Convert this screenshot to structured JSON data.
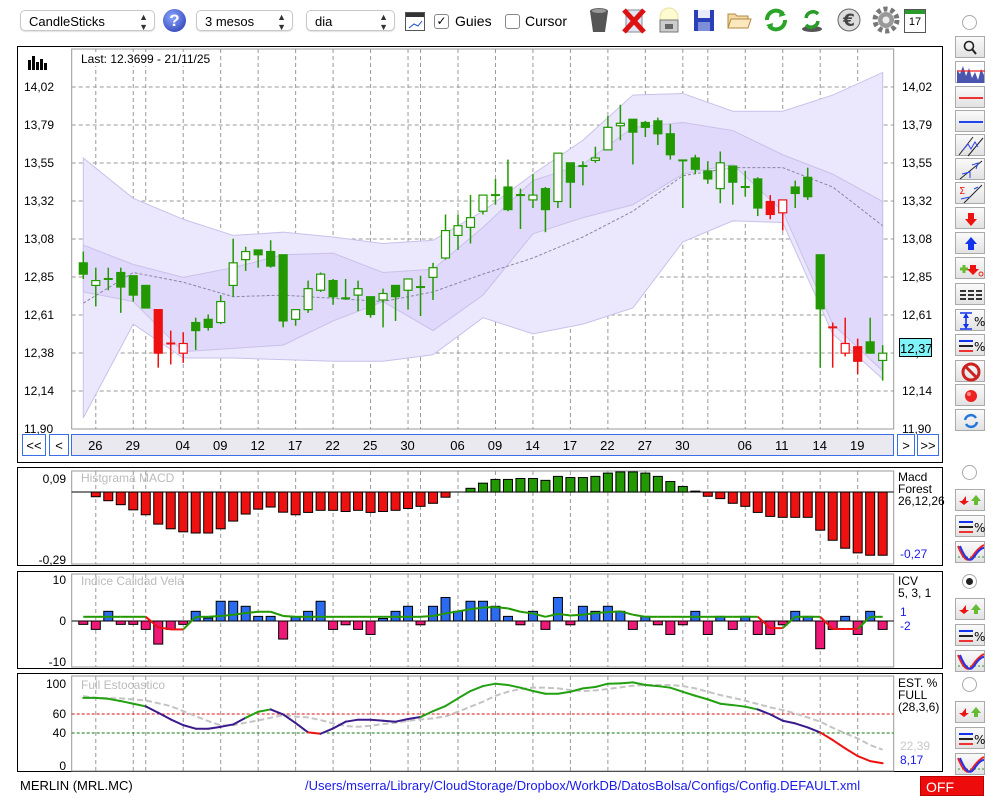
{
  "toolbar": {
    "chart_type": "CandleSticks",
    "period": "3 mesos",
    "interval": "dia",
    "guides_label": "Guies",
    "guides_checked": true,
    "cursor_label": "Cursor",
    "cursor_checked": false,
    "check_mark": "✓",
    "help_glyph": "?",
    "calendar_day": "17",
    "icons": [
      "help-icon",
      "chart-window-icon",
      "trash-icon",
      "delete-icon",
      "lightbulb-icon",
      "save-icon",
      "folder-icon",
      "refresh-icon",
      "recycle-icon",
      "euro-icon",
      "gear-icon",
      "calendar-icon"
    ]
  },
  "main": {
    "last_label": "Last: 12.3699 - 21/11/25",
    "current_price": "12,37",
    "nav": {
      "first": "<<",
      "prev": "<",
      "next": ">",
      "last": ">>"
    },
    "x_labels": [
      {
        "i": 1,
        "label": "26"
      },
      {
        "i": 4,
        "label": "29"
      },
      {
        "i": 8,
        "label": "04"
      },
      {
        "i": 11,
        "label": "09"
      },
      {
        "i": 14,
        "label": "12"
      },
      {
        "i": 17,
        "label": "17"
      },
      {
        "i": 20,
        "label": "22"
      },
      {
        "i": 23,
        "label": "25"
      },
      {
        "i": 26,
        "label": "30"
      },
      {
        "i": 30,
        "label": "06"
      },
      {
        "i": 33,
        "label": "09"
      },
      {
        "i": 36,
        "label": "14"
      },
      {
        "i": 39,
        "label": "17"
      },
      {
        "i": 42,
        "label": "22"
      },
      {
        "i": 45,
        "label": "27"
      },
      {
        "i": 48,
        "label": "30"
      },
      {
        "i": 53,
        "label": "06"
      },
      {
        "i": 56,
        "label": "11"
      },
      {
        "i": 59,
        "label": "14"
      },
      {
        "i": 62,
        "label": "19"
      }
    ],
    "month_grid_indices": [
      5,
      27,
      50
    ]
  },
  "colors": {
    "up": "#229900",
    "alert": "#ee1111",
    "band_outer": "#ebe7fd",
    "band_inner": "#e0d9fb",
    "band_stroke": "#c9c1ea",
    "macd_neg": "#ee1111",
    "macd_pos": "#229900",
    "icv_pos": "#2a6bf0",
    "icv_neg": "#ee1877",
    "k_high": "#22a011",
    "k_mid": "#3a1a8c",
    "k_low": "#ee1111",
    "d_line": "#c4c4c4",
    "link": "#1a1aee",
    "price_box": "#7ff3f7"
  },
  "chart_data": [
    {
      "type": "candlestick",
      "ylim": [
        11.9,
        14.02
      ],
      "y_tick_labels": [
        "14,02",
        "13,79",
        "13,55",
        "13,32",
        "13,08",
        "12,85",
        "12,61",
        "12,38",
        "12,14",
        "11,90"
      ],
      "ohlc_fields": [
        "open",
        "high",
        "low",
        "close",
        "color"
      ],
      "ohlc": [
        [
          12.93,
          13.0,
          12.83,
          12.86,
          "g"
        ],
        [
          12.79,
          12.9,
          12.66,
          12.82,
          "g"
        ],
        [
          12.83,
          12.9,
          12.76,
          12.83,
          "g"
        ],
        [
          12.87,
          12.9,
          12.62,
          12.78,
          "g"
        ],
        [
          12.85,
          12.85,
          12.69,
          12.73,
          "g"
        ],
        [
          12.79,
          12.79,
          12.65,
          12.65,
          "g"
        ],
        [
          12.64,
          12.64,
          12.28,
          12.37,
          "r"
        ],
        [
          12.43,
          12.51,
          12.3,
          12.43,
          "r"
        ],
        [
          12.37,
          12.5,
          12.31,
          12.43,
          "r"
        ],
        [
          12.56,
          12.59,
          12.39,
          12.51,
          "g"
        ],
        [
          12.58,
          12.61,
          12.51,
          12.53,
          "g"
        ],
        [
          12.56,
          12.73,
          12.55,
          12.69,
          "g"
        ],
        [
          12.79,
          13.08,
          12.72,
          12.93,
          "g"
        ],
        [
          12.95,
          13.03,
          12.88,
          13.0,
          "g"
        ],
        [
          13.01,
          13.01,
          12.9,
          12.98,
          "g"
        ],
        [
          13.0,
          13.07,
          12.9,
          12.91,
          "g"
        ],
        [
          12.98,
          12.98,
          12.53,
          12.57,
          "g"
        ],
        [
          12.58,
          12.64,
          12.54,
          12.64,
          "g"
        ],
        [
          12.64,
          12.82,
          12.62,
          12.77,
          "g"
        ],
        [
          12.76,
          12.87,
          12.75,
          12.86,
          "g"
        ],
        [
          12.82,
          12.83,
          12.67,
          12.72,
          "g"
        ],
        [
          12.71,
          12.83,
          12.7,
          12.71,
          "g"
        ],
        [
          12.73,
          12.82,
          12.63,
          12.77,
          "g"
        ],
        [
          12.72,
          12.72,
          12.59,
          12.61,
          "g"
        ],
        [
          12.7,
          12.77,
          12.53,
          12.74,
          "g"
        ],
        [
          12.79,
          12.79,
          12.57,
          12.72,
          "g"
        ],
        [
          12.76,
          12.83,
          12.64,
          12.83,
          "g"
        ],
        [
          12.78,
          12.85,
          12.6,
          12.78,
          "g"
        ],
        [
          12.84,
          12.93,
          12.7,
          12.9,
          "g"
        ],
        [
          12.96,
          13.23,
          12.95,
          13.13,
          "g"
        ],
        [
          13.1,
          13.23,
          13.01,
          13.16,
          "g"
        ],
        [
          13.15,
          13.35,
          13.05,
          13.21,
          "g"
        ],
        [
          13.25,
          13.35,
          13.23,
          13.35,
          "g"
        ],
        [
          13.35,
          13.45,
          13.29,
          13.35,
          "g"
        ],
        [
          13.4,
          13.57,
          13.25,
          13.26,
          "g"
        ],
        [
          13.35,
          13.39,
          13.14,
          13.35,
          "g"
        ],
        [
          13.32,
          13.48,
          13.27,
          13.35,
          "g"
        ],
        [
          13.39,
          13.4,
          13.12,
          13.26,
          "g"
        ],
        [
          13.31,
          13.61,
          13.27,
          13.61,
          "g"
        ],
        [
          13.55,
          13.55,
          13.27,
          13.43,
          "g"
        ],
        [
          13.53,
          13.56,
          13.41,
          13.53,
          "g"
        ],
        [
          13.565,
          13.65,
          13.55,
          13.58,
          "g"
        ],
        [
          13.63,
          13.84,
          13.63,
          13.77,
          "g"
        ],
        [
          13.78,
          13.91,
          13.69,
          13.795,
          "g"
        ],
        [
          13.82,
          13.82,
          13.54,
          13.74,
          "g"
        ],
        [
          13.8,
          13.81,
          13.71,
          13.77,
          "g"
        ],
        [
          13.81,
          13.83,
          13.66,
          13.73,
          "g"
        ],
        [
          13.73,
          13.79,
          13.57,
          13.6,
          "g"
        ],
        [
          13.565,
          13.565,
          13.27,
          13.565,
          "g"
        ],
        [
          13.58,
          13.6,
          13.48,
          13.51,
          "g"
        ],
        [
          13.5,
          13.56,
          13.42,
          13.45,
          "g"
        ],
        [
          13.39,
          13.62,
          13.3,
          13.55,
          "g"
        ],
        [
          13.53,
          13.53,
          13.29,
          13.43,
          "g"
        ],
        [
          13.4,
          13.5,
          13.34,
          13.4,
          "g"
        ],
        [
          13.45,
          13.46,
          13.22,
          13.27,
          "g"
        ],
        [
          13.31,
          13.35,
          13.2,
          13.23,
          "r"
        ],
        [
          13.24,
          13.32,
          13.13,
          13.32,
          "r"
        ],
        [
          13.4,
          13.44,
          13.27,
          13.36,
          "g"
        ],
        [
          13.46,
          13.52,
          13.32,
          13.34,
          "g"
        ],
        [
          12.98,
          12.98,
          12.28,
          12.645,
          "g"
        ],
        [
          12.53,
          12.56,
          12.28,
          12.53,
          "r"
        ],
        [
          12.37,
          12.59,
          12.35,
          12.43,
          "r"
        ],
        [
          12.41,
          12.46,
          12.24,
          12.32,
          "r"
        ],
        [
          12.44,
          12.59,
          12.37,
          12.37,
          "g"
        ],
        [
          12.325,
          12.42,
          12.2,
          12.37,
          "g"
        ]
      ],
      "bands": {
        "index": [
          0,
          4,
          8,
          12,
          16,
          20,
          24,
          28,
          32,
          36,
          40,
          44,
          48,
          52,
          56,
          60,
          64
        ],
        "outer_upper": [
          13.58,
          13.33,
          13.2,
          13.1,
          13.12,
          13.09,
          13.05,
          13.07,
          13.25,
          13.48,
          13.69,
          13.97,
          13.98,
          13.87,
          13.87,
          13.97,
          14.11
        ],
        "inner_upper": [
          13.04,
          12.92,
          12.84,
          12.9,
          12.98,
          12.99,
          12.87,
          12.89,
          13.15,
          13.44,
          13.54,
          13.77,
          13.8,
          13.75,
          13.6,
          13.48,
          13.31
        ],
        "inner_lower": [
          12.75,
          12.69,
          12.38,
          12.4,
          12.42,
          12.57,
          12.69,
          12.51,
          12.73,
          13.11,
          13.21,
          13.29,
          13.48,
          13.54,
          13.25,
          12.55,
          12.26
        ],
        "outer_lower": [
          11.97,
          12.55,
          12.34,
          12.34,
          12.33,
          12.32,
          12.32,
          12.36,
          12.59,
          12.49,
          12.55,
          12.65,
          13.06,
          13.19,
          13.18,
          12.49,
          12.21
        ],
        "moving_average": [
          12.68,
          12.87,
          12.81,
          12.72,
          12.73,
          12.71,
          12.69,
          12.75,
          12.86,
          12.96,
          13.09,
          13.25,
          13.47,
          13.52,
          13.52,
          13.4,
          13.16
        ]
      }
    },
    {
      "type": "bar",
      "title": "Histgrama MACD",
      "ylim": [
        -0.29,
        0.09
      ],
      "y_tick_labels": [
        "0,09",
        "-0,29"
      ],
      "legend": [
        "Macd",
        "Forest",
        "26,12,26"
      ],
      "last_value": "-0,27",
      "values": [
        null,
        -0.02,
        -0.037,
        -0.054,
        -0.076,
        -0.097,
        -0.137,
        -0.157,
        -0.17,
        -0.175,
        -0.175,
        -0.157,
        -0.124,
        -0.094,
        -0.073,
        -0.064,
        -0.086,
        -0.097,
        -0.087,
        -0.078,
        -0.078,
        -0.083,
        -0.078,
        -0.087,
        -0.083,
        -0.078,
        -0.07,
        -0.061,
        -0.048,
        -0.022,
        0.0,
        0.016,
        0.038,
        0.054,
        0.054,
        0.058,
        0.058,
        0.05,
        0.067,
        0.062,
        0.062,
        0.067,
        0.081,
        0.086,
        0.086,
        0.081,
        0.067,
        0.045,
        0.024,
        0.004,
        -0.018,
        -0.028,
        -0.048,
        -0.061,
        -0.087,
        -0.104,
        -0.108,
        -0.108,
        -0.108,
        -0.163,
        -0.206,
        -0.24,
        -0.26,
        -0.27,
        -0.27
      ]
    },
    {
      "type": "bar",
      "title": "Indice Calidad Vela",
      "ylim": [
        -10,
        10
      ],
      "y_tick_labels": [
        "10",
        "0",
        "-10"
      ],
      "legend": [
        "ICV",
        "5, 3, 1"
      ],
      "last_values": [
        "1",
        "-2"
      ],
      "values": [
        -0.8,
        -2,
        2.3,
        -0.8,
        -0.8,
        -2,
        -5.5,
        -2,
        -0.8,
        2.3,
        0.7,
        4.7,
        4.7,
        3.5,
        1.1,
        1.1,
        -4.3,
        1,
        2.3,
        4.7,
        -2,
        -0.9,
        -2,
        -3.2,
        0.6,
        2.3,
        3.5,
        -0.9,
        3.5,
        5.6,
        2.3,
        4.7,
        4.7,
        3.5,
        1.1,
        -0.9,
        2.3,
        -2,
        5.6,
        -0.9,
        3.5,
        2.3,
        3.5,
        2.3,
        -2,
        1.1,
        -0.9,
        -3.2,
        -0.9,
        2.3,
        -3.2,
        1.1,
        -2,
        1.1,
        -3.2,
        -3.2,
        -0.9,
        2.3,
        1.1,
        -6.6,
        -2,
        1.1,
        -3.2,
        2.3,
        -2
      ],
      "signal": [
        1,
        1,
        1,
        1,
        1,
        1,
        -1.5,
        -2,
        -2,
        1,
        1,
        1.2,
        1.5,
        1.9,
        2.2,
        2.2,
        1.2,
        1,
        1,
        1,
        1,
        1,
        1,
        1,
        1,
        1,
        1,
        1,
        1.2,
        1.8,
        2.3,
        2.8,
        3.2,
        3.3,
        3,
        2.2,
        1.8,
        1,
        1.7,
        1.3,
        1.5,
        1.9,
        2.1,
        2.3,
        1.5,
        1,
        1,
        1,
        1,
        1,
        1,
        1,
        1,
        1,
        1,
        -1.7,
        -1.7,
        1,
        1,
        1,
        -1.9,
        -1.9,
        -1.9,
        1,
        1
      ]
    },
    {
      "type": "line",
      "title": "Full Estocastico",
      "ylim": [
        0,
        100
      ],
      "y_tick_labels": [
        {
          "v": 100,
          "label": "100"
        },
        {
          "v": 60,
          "label": "60"
        },
        {
          "v": 40,
          "label": "40"
        },
        {
          "v": 0,
          "label": "0"
        }
      ],
      "levels": [
        60,
        40
      ],
      "legend": [
        "EST. %",
        "FULL",
        "(28,3,6)"
      ],
      "last_values": [
        "22,39",
        "8,17"
      ],
      "k": [
        77,
        77,
        76,
        73.6,
        70.8,
        68,
        61.3,
        54.3,
        48.3,
        44.5,
        44.5,
        46.5,
        49,
        56,
        62.4,
        64.8,
        59.5,
        50.5,
        40.6,
        39.2,
        44.8,
        51.9,
        54,
        54,
        52.9,
        51.9,
        54.7,
        56.8,
        63,
        68.4,
        76.4,
        84.2,
        89.4,
        91.9,
        90.5,
        87.7,
        84.2,
        81.3,
        81.3,
        83.4,
        87,
        88.4,
        91.9,
        92.2,
        93.3,
        90.5,
        89.4,
        87.7,
        83.4,
        79.2,
        75.4,
        70.8,
        69.4,
        67.7,
        64.8,
        59.6,
        52.9,
        50.1,
        45.9,
        40.6,
        32.6,
        23.8,
        15.7,
        10.4,
        8.17
      ],
      "d": [
        78.8,
        77,
        76.7,
        76.4,
        75.4,
        74.3,
        71.3,
        68.3,
        63,
        57.8,
        52.5,
        48,
        48.3,
        50.8,
        53.2,
        56,
        58.8,
        57.2,
        56.4,
        53.6,
        50.1,
        47.3,
        46.6,
        47.6,
        49.4,
        50.8,
        52.9,
        54.3,
        55.4,
        57.5,
        62.4,
        67.7,
        72.9,
        79.2,
        83.4,
        86.3,
        87.7,
        87.7,
        87,
        85.2,
        84.2,
        84.8,
        86.3,
        88,
        89.8,
        90.5,
        90.5,
        90.5,
        89.4,
        87,
        83.4,
        79.9,
        77.1,
        74,
        70.5,
        67,
        64.1,
        60.6,
        56.4,
        51.9,
        45.5,
        39.6,
        34.3,
        27.3,
        22.39
      ]
    }
  ],
  "footer": {
    "symbol": "MERLIN (MRL.MC)",
    "config_path": "/Users/mserra/Library/CloudStorage/Dropbox/WorkDB/DatosBolsa/Configs/Config.DEFAULT.xml",
    "status": "OFF"
  }
}
